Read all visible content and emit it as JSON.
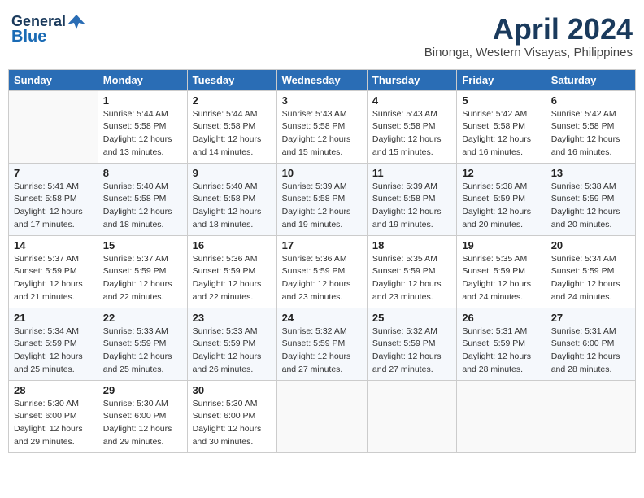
{
  "header": {
    "logo_line1": "General",
    "logo_line2": "Blue",
    "title": "April 2024",
    "subtitle": "Binonga, Western Visayas, Philippines"
  },
  "weekdays": [
    "Sunday",
    "Monday",
    "Tuesday",
    "Wednesday",
    "Thursday",
    "Friday",
    "Saturday"
  ],
  "weeks": [
    [
      {
        "day": "",
        "info": ""
      },
      {
        "day": "1",
        "info": "Sunrise: 5:44 AM\nSunset: 5:58 PM\nDaylight: 12 hours\nand 13 minutes."
      },
      {
        "day": "2",
        "info": "Sunrise: 5:44 AM\nSunset: 5:58 PM\nDaylight: 12 hours\nand 14 minutes."
      },
      {
        "day": "3",
        "info": "Sunrise: 5:43 AM\nSunset: 5:58 PM\nDaylight: 12 hours\nand 15 minutes."
      },
      {
        "day": "4",
        "info": "Sunrise: 5:43 AM\nSunset: 5:58 PM\nDaylight: 12 hours\nand 15 minutes."
      },
      {
        "day": "5",
        "info": "Sunrise: 5:42 AM\nSunset: 5:58 PM\nDaylight: 12 hours\nand 16 minutes."
      },
      {
        "day": "6",
        "info": "Sunrise: 5:42 AM\nSunset: 5:58 PM\nDaylight: 12 hours\nand 16 minutes."
      }
    ],
    [
      {
        "day": "7",
        "info": "Sunrise: 5:41 AM\nSunset: 5:58 PM\nDaylight: 12 hours\nand 17 minutes."
      },
      {
        "day": "8",
        "info": "Sunrise: 5:40 AM\nSunset: 5:58 PM\nDaylight: 12 hours\nand 18 minutes."
      },
      {
        "day": "9",
        "info": "Sunrise: 5:40 AM\nSunset: 5:58 PM\nDaylight: 12 hours\nand 18 minutes."
      },
      {
        "day": "10",
        "info": "Sunrise: 5:39 AM\nSunset: 5:58 PM\nDaylight: 12 hours\nand 19 minutes."
      },
      {
        "day": "11",
        "info": "Sunrise: 5:39 AM\nSunset: 5:58 PM\nDaylight: 12 hours\nand 19 minutes."
      },
      {
        "day": "12",
        "info": "Sunrise: 5:38 AM\nSunset: 5:59 PM\nDaylight: 12 hours\nand 20 minutes."
      },
      {
        "day": "13",
        "info": "Sunrise: 5:38 AM\nSunset: 5:59 PM\nDaylight: 12 hours\nand 20 minutes."
      }
    ],
    [
      {
        "day": "14",
        "info": "Sunrise: 5:37 AM\nSunset: 5:59 PM\nDaylight: 12 hours\nand 21 minutes."
      },
      {
        "day": "15",
        "info": "Sunrise: 5:37 AM\nSunset: 5:59 PM\nDaylight: 12 hours\nand 22 minutes."
      },
      {
        "day": "16",
        "info": "Sunrise: 5:36 AM\nSunset: 5:59 PM\nDaylight: 12 hours\nand 22 minutes."
      },
      {
        "day": "17",
        "info": "Sunrise: 5:36 AM\nSunset: 5:59 PM\nDaylight: 12 hours\nand 23 minutes."
      },
      {
        "day": "18",
        "info": "Sunrise: 5:35 AM\nSunset: 5:59 PM\nDaylight: 12 hours\nand 23 minutes."
      },
      {
        "day": "19",
        "info": "Sunrise: 5:35 AM\nSunset: 5:59 PM\nDaylight: 12 hours\nand 24 minutes."
      },
      {
        "day": "20",
        "info": "Sunrise: 5:34 AM\nSunset: 5:59 PM\nDaylight: 12 hours\nand 24 minutes."
      }
    ],
    [
      {
        "day": "21",
        "info": "Sunrise: 5:34 AM\nSunset: 5:59 PM\nDaylight: 12 hours\nand 25 minutes."
      },
      {
        "day": "22",
        "info": "Sunrise: 5:33 AM\nSunset: 5:59 PM\nDaylight: 12 hours\nand 25 minutes."
      },
      {
        "day": "23",
        "info": "Sunrise: 5:33 AM\nSunset: 5:59 PM\nDaylight: 12 hours\nand 26 minutes."
      },
      {
        "day": "24",
        "info": "Sunrise: 5:32 AM\nSunset: 5:59 PM\nDaylight: 12 hours\nand 27 minutes."
      },
      {
        "day": "25",
        "info": "Sunrise: 5:32 AM\nSunset: 5:59 PM\nDaylight: 12 hours\nand 27 minutes."
      },
      {
        "day": "26",
        "info": "Sunrise: 5:31 AM\nSunset: 5:59 PM\nDaylight: 12 hours\nand 28 minutes."
      },
      {
        "day": "27",
        "info": "Sunrise: 5:31 AM\nSunset: 6:00 PM\nDaylight: 12 hours\nand 28 minutes."
      }
    ],
    [
      {
        "day": "28",
        "info": "Sunrise: 5:30 AM\nSunset: 6:00 PM\nDaylight: 12 hours\nand 29 minutes."
      },
      {
        "day": "29",
        "info": "Sunrise: 5:30 AM\nSunset: 6:00 PM\nDaylight: 12 hours\nand 29 minutes."
      },
      {
        "day": "30",
        "info": "Sunrise: 5:30 AM\nSunset: 6:00 PM\nDaylight: 12 hours\nand 30 minutes."
      },
      {
        "day": "",
        "info": ""
      },
      {
        "day": "",
        "info": ""
      },
      {
        "day": "",
        "info": ""
      },
      {
        "day": "",
        "info": ""
      }
    ]
  ]
}
